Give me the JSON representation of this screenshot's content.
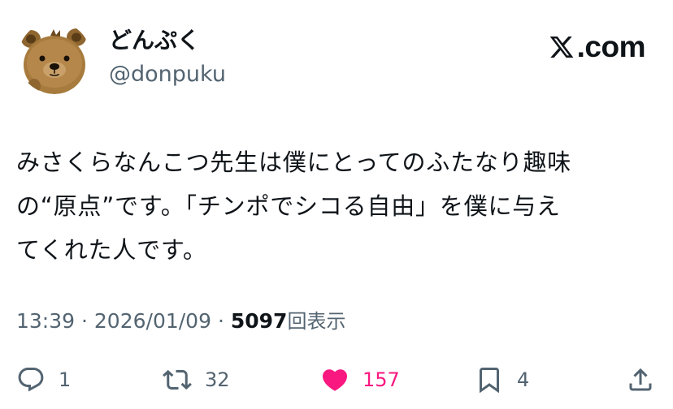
{
  "author": {
    "display_name": "どんぷく",
    "handle": "@donpuku",
    "avatar_icon": "bear-avatar-icon"
  },
  "site": {
    "domain_text": ".com",
    "logo_icon": "x-logo-icon"
  },
  "tweet": {
    "lines": [
      "みさくらなんこつ先生は僕にとってのふたなり趣味",
      "の“原点”です。「チンポでシコる自由」を僕に与え",
      "てくれた人です。"
    ]
  },
  "meta": {
    "time": "13:39",
    "separator": "·",
    "date": "2026/01/09",
    "views_count": "5097",
    "views_label": "回表示"
  },
  "actions": {
    "reply": {
      "icon": "reply-icon",
      "count": "1"
    },
    "retweet": {
      "icon": "retweet-icon",
      "count": "32"
    },
    "like": {
      "icon": "heart-icon",
      "count": "157",
      "active": true
    },
    "bookmark": {
      "icon": "bookmark-icon",
      "count": "4"
    },
    "share": {
      "icon": "share-icon"
    }
  },
  "colors": {
    "text": "#0f1419",
    "secondary": "#536471",
    "like": "#f91880",
    "avatar_fur": "#a77b3d"
  }
}
